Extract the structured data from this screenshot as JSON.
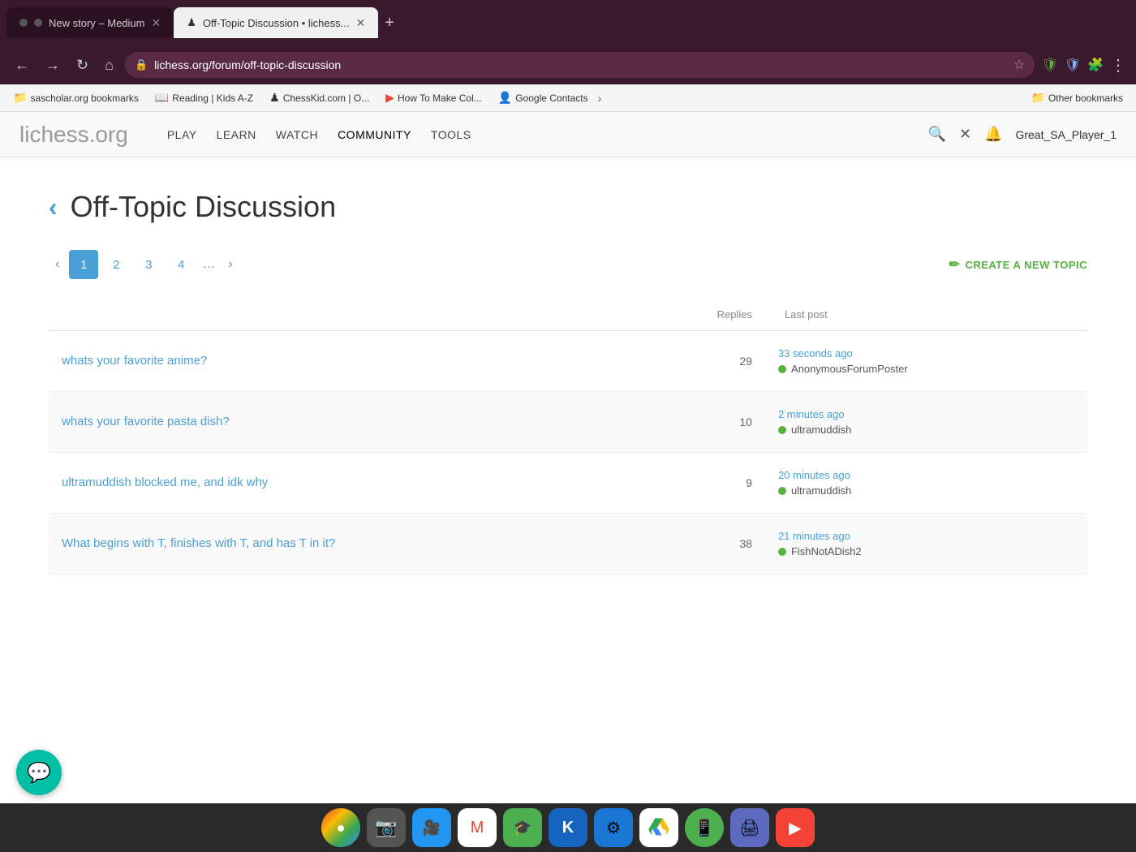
{
  "browser": {
    "tabs": [
      {
        "id": "tab-medium",
        "label": "New story – Medium",
        "active": false,
        "dot": true
      },
      {
        "id": "tab-lichess",
        "label": "Off-Topic Discussion • lichess...",
        "active": true,
        "favicon": "♟"
      }
    ],
    "address": "lichess.org/forum/off-topic-discussion",
    "bookmarks": [
      {
        "id": "bm-sascholar",
        "label": "sascholar.org bookmarks",
        "icon": "📁"
      },
      {
        "id": "bm-reading",
        "label": "Reading | Kids A-Z",
        "icon": "📖"
      },
      {
        "id": "bm-chesskid",
        "label": "ChessKid.com | O...",
        "icon": "♟"
      },
      {
        "id": "bm-howtomake",
        "label": "How To Make Col...",
        "icon": "▶"
      },
      {
        "id": "bm-googlecontacts",
        "label": "Google Contacts",
        "icon": "👤"
      },
      {
        "id": "bm-other",
        "label": "Other bookmarks",
        "icon": "📁"
      }
    ]
  },
  "lichess": {
    "logo": "lichess",
    "logo_tld": ".org",
    "nav": {
      "items": [
        "PLAY",
        "LEARN",
        "WATCH",
        "COMMUNITY",
        "TOOLS"
      ],
      "active": "COMMUNITY"
    },
    "username": "Great_SA_Player_1"
  },
  "forum": {
    "back_label": "‹",
    "title": "Off-Topic Discussion",
    "pagination": {
      "current": 1,
      "pages": [
        "1",
        "2",
        "3",
        "4"
      ],
      "dots": "…"
    },
    "create_topic_label": "CREATE A NEW TOPIC",
    "table_headers": {
      "replies": "Replies",
      "last_post": "Last post"
    },
    "topics": [
      {
        "id": "topic-anime",
        "title": "whats your favorite anime?",
        "replies": 29,
        "last_post_time": "33 seconds ago",
        "last_post_user": "AnonymousForumPoster",
        "online": true
      },
      {
        "id": "topic-pasta",
        "title": "whats your favorite pasta dish?",
        "replies": 10,
        "last_post_time": "2 minutes ago",
        "last_post_user": "ultramuddish",
        "online": true
      },
      {
        "id": "topic-blocked",
        "title": "ultramuddish blocked me, and idk why",
        "replies": 9,
        "last_post_time": "20 minutes ago",
        "last_post_user": "ultramuddish",
        "online": true
      },
      {
        "id": "topic-riddle",
        "title": "What begins with T, finishes with T, and has T in it?",
        "replies": 38,
        "last_post_time": "21 minutes ago",
        "last_post_user": "FishNotADish2",
        "online": true
      }
    ]
  },
  "taskbar": {
    "icons": [
      {
        "id": "chrome",
        "label": "Chrome",
        "bg": "#fff",
        "symbol": "🌐"
      },
      {
        "id": "camera",
        "label": "Camera",
        "bg": "#444",
        "symbol": "📷"
      },
      {
        "id": "zoom",
        "label": "Zoom",
        "bg": "#2196f3",
        "symbol": "🎥"
      },
      {
        "id": "gmail",
        "label": "Gmail",
        "bg": "#fff",
        "symbol": "✉"
      },
      {
        "id": "classroom",
        "label": "Google Classroom",
        "bg": "#4caf50",
        "symbol": "🎓"
      },
      {
        "id": "klack",
        "label": "Klack",
        "bg": "#1565c0",
        "symbol": "K"
      },
      {
        "id": "settings",
        "label": "Settings",
        "bg": "#1976d2",
        "symbol": "⚙"
      },
      {
        "id": "drive",
        "label": "Google Drive",
        "bg": "#fff",
        "symbol": "△"
      },
      {
        "id": "phone",
        "label": "Phone",
        "bg": "#4caf50",
        "symbol": "📱"
      },
      {
        "id": "printer",
        "label": "Printer",
        "bg": "#5c6bc0",
        "symbol": "🖨"
      },
      {
        "id": "youtube",
        "label": "YouTube",
        "bg": "#f44336",
        "symbol": "▶"
      }
    ]
  },
  "chat": {
    "symbol": "💬"
  }
}
